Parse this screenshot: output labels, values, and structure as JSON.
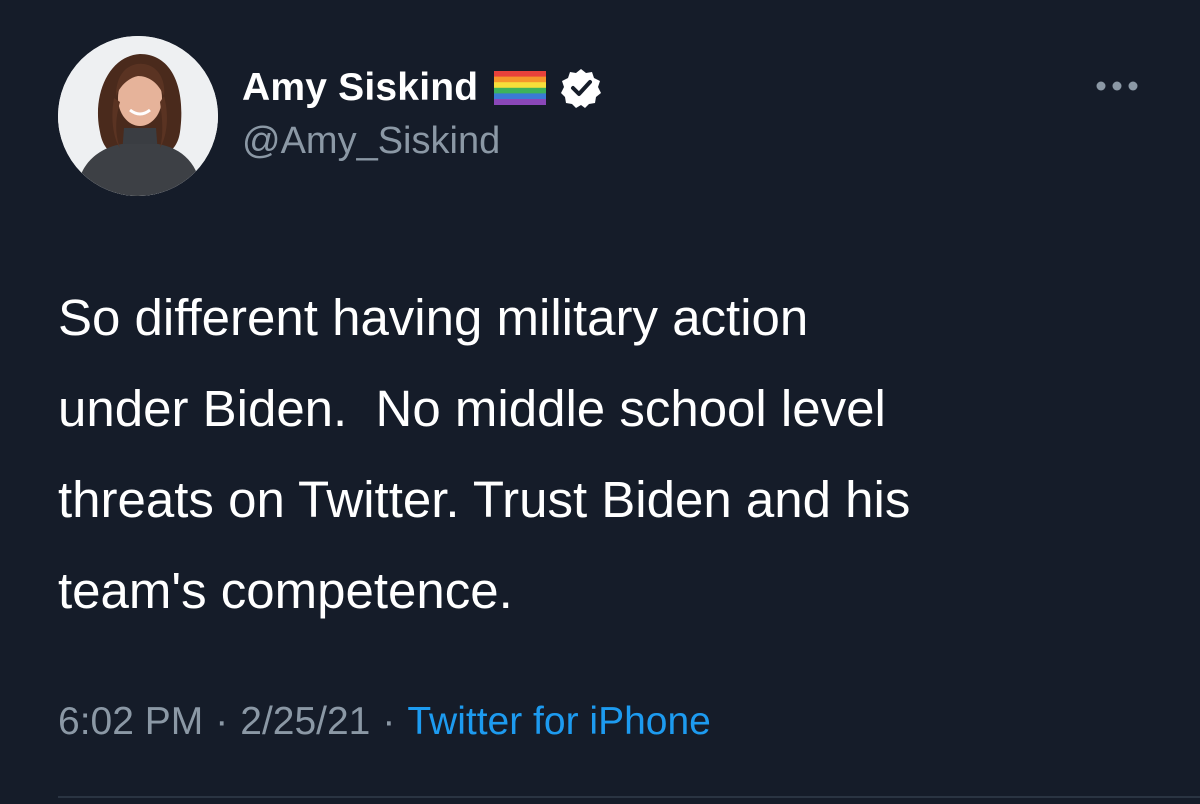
{
  "tweet": {
    "author": {
      "display_name": "Amy Siskind",
      "handle": "@Amy_Siskind",
      "badges": [
        "rainbow-flag-icon",
        "verified-badge-icon"
      ]
    },
    "text": "So different having military action\nunder Biden.  No middle school level\nthreats on Twitter. Trust Biden and his\nteam's competence.",
    "time": "6:02 PM",
    "separator": "·",
    "date": "2/25/21",
    "source": "Twitter for iPhone"
  },
  "colors": {
    "background": "#151c29",
    "primary_text": "#ffffff",
    "secondary_text": "#8b98a5",
    "link": "#1d9bf0"
  }
}
